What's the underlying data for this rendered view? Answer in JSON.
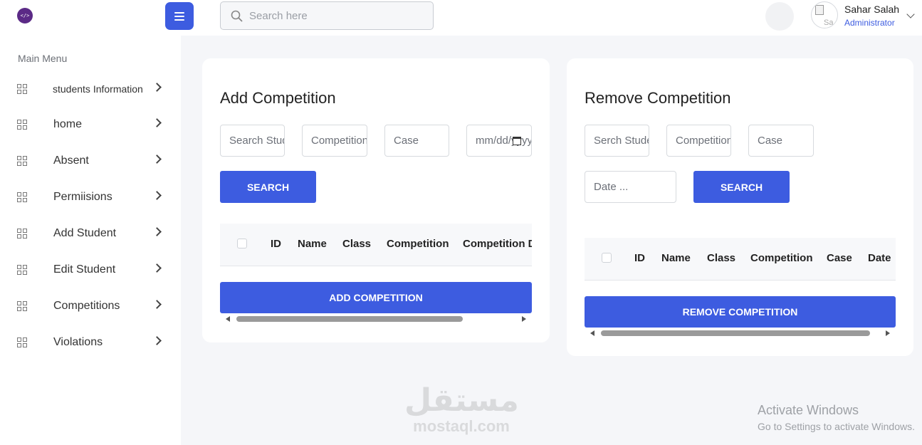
{
  "app": {
    "logo_text": "</>"
  },
  "sidebar": {
    "menu_title": "Main Menu",
    "items": [
      {
        "label": "students Information"
      },
      {
        "label": "home"
      },
      {
        "label": "Absent"
      },
      {
        "label": "Permiisions"
      },
      {
        "label": "Add Student"
      },
      {
        "label": "Edit Student"
      },
      {
        "label": "Competitions"
      },
      {
        "label": "Violations"
      }
    ]
  },
  "header": {
    "search_placeholder": "Search here",
    "user_name": "Sahar Salah",
    "user_role": "Administrator",
    "avatar_alt": "Sa"
  },
  "add_card": {
    "title": "Add Competition",
    "inputs": [
      "Search Student",
      "Competition",
      "Case",
      "mm/dd/yyyy"
    ],
    "search_label": "SEARCH",
    "columns": [
      "ID",
      "Name",
      "Class",
      "Competition",
      "Competition Date"
    ],
    "action_label": "ADD COMPETITION"
  },
  "remove_card": {
    "title": "Remove Competition",
    "inputs": [
      "Serch Student",
      "Competition",
      "Case",
      "Date ..."
    ],
    "search_label": "SEARCH",
    "columns": [
      "ID",
      "Name",
      "Class",
      "Competition",
      "Case",
      "Date"
    ],
    "action_label": "REMOVE COMPETITION"
  },
  "watermark": {
    "arabic": "مستقل",
    "latin": "mostaql.com"
  },
  "windows_notice": {
    "line1": "Activate Windows",
    "line2": "Go to Settings to activate Windows."
  },
  "colors": {
    "accent": "#3d5ce0",
    "background": "#f5f6f9"
  }
}
